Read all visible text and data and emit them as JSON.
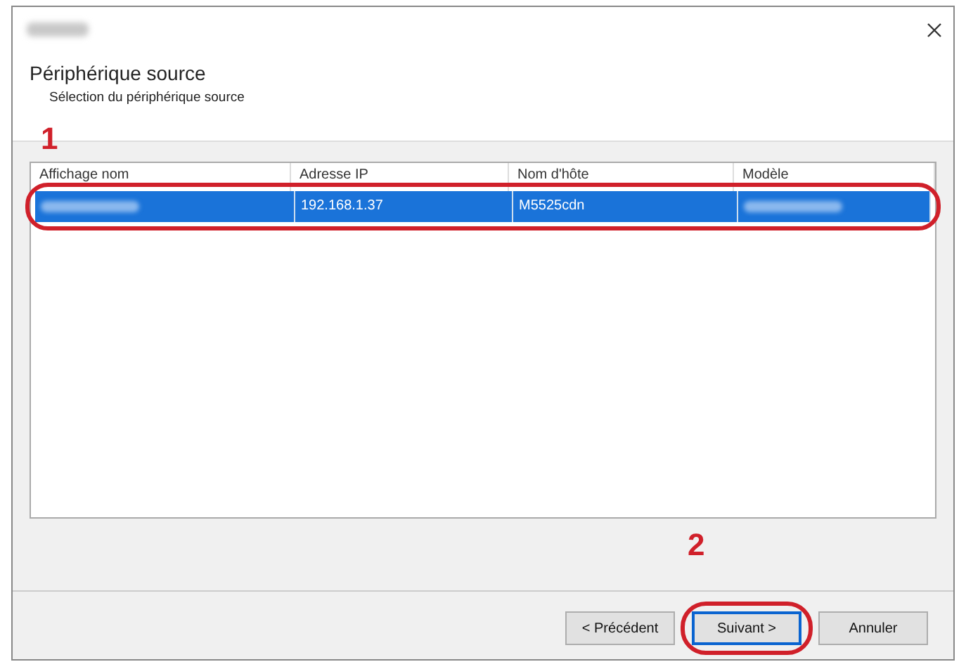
{
  "header": {
    "title": "Périphérique source",
    "subtitle": "Sélection du périphérique source"
  },
  "table": {
    "columns": [
      "Affichage nom",
      "Adresse IP",
      "Nom d'hôte",
      "Modèle"
    ],
    "rows": [
      {
        "selected": true,
        "cells": [
          {
            "kind": "blurred"
          },
          {
            "kind": "text",
            "text": "192.168.1.37"
          },
          {
            "kind": "text",
            "text": "M5525cdn"
          },
          {
            "kind": "blurred"
          }
        ]
      }
    ]
  },
  "buttons": [
    {
      "label": "< Précédent",
      "focused": false
    },
    {
      "label": "Suivant >",
      "focused": true
    },
    {
      "label": "Annuler",
      "focused": false
    }
  ],
  "callouts": [
    {
      "label": "1"
    },
    {
      "label": "2"
    }
  ]
}
